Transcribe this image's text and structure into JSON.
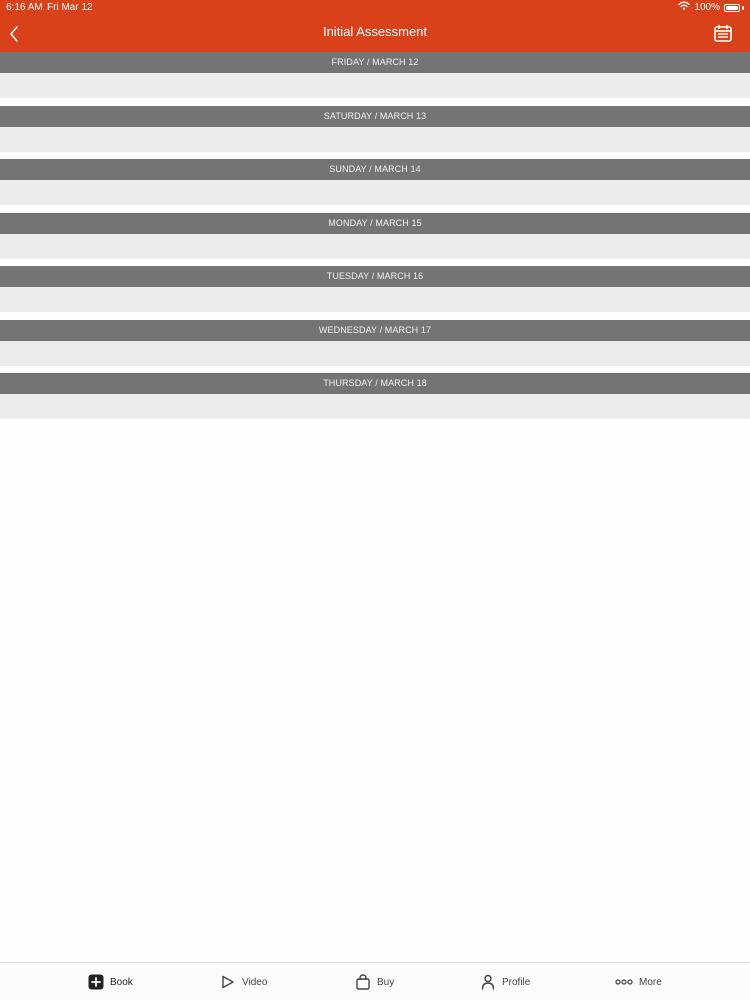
{
  "status": {
    "time": "6:16 AM",
    "date": "Fri Mar 12",
    "battery": "100%"
  },
  "header": {
    "title": "Initial Assessment",
    "accent": "#d8411a"
  },
  "days": [
    {
      "label": "FRIDAY / MARCH 12"
    },
    {
      "label": "SATURDAY / MARCH 13"
    },
    {
      "label": "SUNDAY / MARCH 14"
    },
    {
      "label": "MONDAY / MARCH 15"
    },
    {
      "label": "TUESDAY / MARCH 16"
    },
    {
      "label": "WEDNESDAY / MARCH 17"
    },
    {
      "label": "THURSDAY / MARCH 18"
    }
  ],
  "tabbar": {
    "book": "Book",
    "video": "Video",
    "buy": "Buy",
    "profile": "Profile",
    "more": "More"
  },
  "icons": {
    "back": "chevron-left-icon",
    "calendar": "calendar-icon",
    "book": "plus-square-icon",
    "video": "play-icon",
    "buy": "shopping-bag-icon",
    "profile": "person-icon",
    "more": "ellipsis-icon",
    "wifi": "wifi-icon",
    "battery": "battery-icon"
  }
}
